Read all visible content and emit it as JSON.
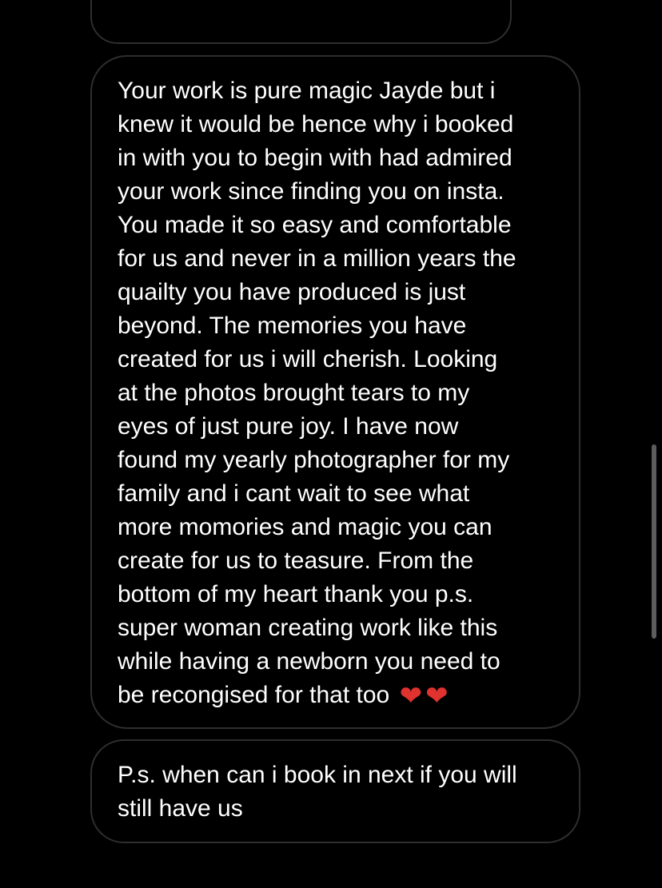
{
  "conversation": {
    "main_message": {
      "lines": [
        "Your work is pure magic Jayde but i",
        "knew it would be hence why i booked",
        "in with you to begin with had admired",
        "your work since finding you on insta.",
        "You made it so easy and comfortable",
        "for us and never in a million years the",
        "quailty you have produced is just",
        "beyond. The memories you have",
        "created for us i will cherish. Looking",
        "at the photos brought tears to my",
        "eyes of just pure joy. I have now",
        "found my yearly photographer for my",
        "family and i cant wait to see what",
        "more momories and magic you can",
        "create for us to teasure. From the",
        "bottom of my heart thank you p.s.",
        "super woman creating work like this",
        "while having a newborn you need to",
        "be recongised for that too"
      ],
      "emoji": [
        "red-heart",
        "red-heart"
      ],
      "emoji_glyph": "❤"
    },
    "ps_message": {
      "lines": [
        "P.s. when can i book in next if you will",
        "still have us"
      ]
    }
  },
  "colors": {
    "background": "#000000",
    "bubble_border": "#2e2e2e",
    "text": "#ffffff",
    "heart": "#e0322f",
    "scrollbar": "#5c5c5c"
  }
}
